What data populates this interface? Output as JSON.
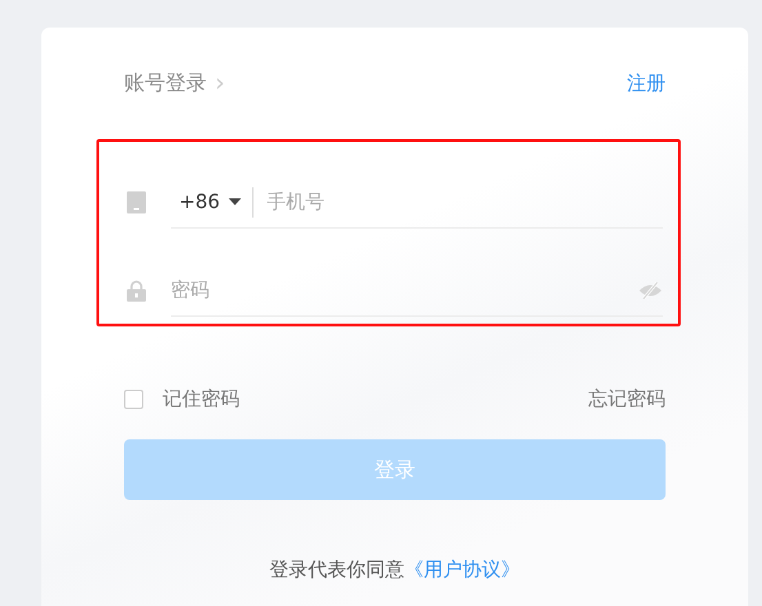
{
  "header": {
    "title": "账号登录",
    "chevron": "›",
    "register_link": "注册"
  },
  "fields": {
    "highlighted": true,
    "country_code": "+86",
    "phone": {
      "placeholder": "手机号"
    },
    "password": {
      "placeholder": "密码"
    }
  },
  "remember": {
    "label": "记住密码",
    "checked": false
  },
  "forgot_link": "忘记密码",
  "login_button": {
    "label": "登录",
    "disabled": true
  },
  "agreement": {
    "text": "登录代表你同意",
    "link": "《用户协议》"
  }
}
